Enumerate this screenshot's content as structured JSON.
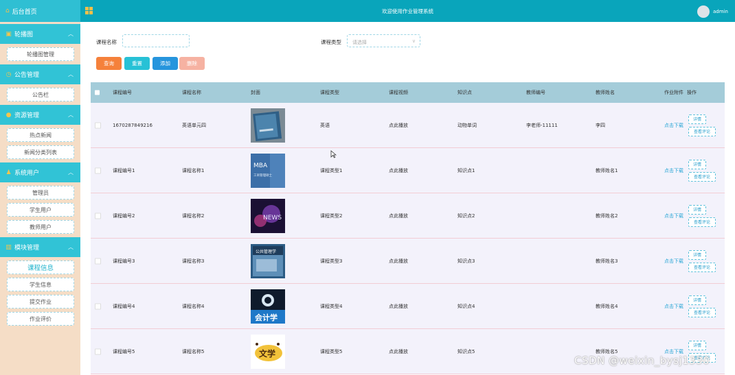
{
  "sidebar": {
    "home": {
      "label": "后台首页",
      "icon": "home-icon"
    },
    "sections": [
      {
        "title": "轮播图",
        "icon": "image-icon",
        "items": [
          "轮播图管理"
        ]
      },
      {
        "title": "公告管理",
        "icon": "clock-icon",
        "items": [
          "公告栏"
        ]
      },
      {
        "title": "资源管理",
        "icon": "pin-icon",
        "items": [
          "热点新闻",
          "新闻分类列表"
        ]
      },
      {
        "title": "系统用户",
        "icon": "user-icon",
        "items": [
          "管理员",
          "学生用户",
          "教师用户"
        ]
      },
      {
        "title": "模块管理",
        "icon": "module-icon",
        "items": [
          "课程信息",
          "学生信息",
          "提交作业",
          "作业评价"
        ]
      }
    ]
  },
  "topbar": {
    "title": "欢迎使用作业管理系统",
    "user": "admin"
  },
  "search": {
    "course_name_label": "课程名称",
    "course_name_value": "",
    "course_type_label": "课程类型",
    "course_type_placeholder": "请选择"
  },
  "buttons": {
    "query": "查询",
    "reset": "重置",
    "add": "添加",
    "delete": "删除"
  },
  "colors": {
    "query": "#f5813b",
    "reset": "#27c1d6",
    "add": "#2695dd",
    "delete": "#f6b2a2",
    "sidebar_head": "#31c3d6",
    "topbar": "#09a5bb"
  },
  "table": {
    "headers": [
      "课程编号",
      "课程名称",
      "封面",
      "课程类型",
      "课程视频",
      "知识点",
      "教师编号",
      "教师姓名",
      "作业附件",
      "操作"
    ],
    "rows": [
      {
        "id": "1670287849216",
        "name": "英语单元四",
        "cover": "cover-book-blue",
        "type": "英语",
        "video": "点此播放",
        "knowledge": "动物单词",
        "teacher_id": "李老师-11111",
        "teacher_name": "李四",
        "attachment": "点击下载"
      },
      {
        "id": "课程编号1",
        "name": "课程名称1",
        "cover": "cover-mba",
        "type": "课程类型1",
        "video": "点此播放",
        "knowledge": "知识点1",
        "teacher_id": "",
        "teacher_name": "教师姓名1",
        "attachment": "点击下载"
      },
      {
        "id": "课程编号2",
        "name": "课程名称2",
        "cover": "cover-news",
        "type": "课程类型2",
        "video": "点此播放",
        "knowledge": "知识点2",
        "teacher_id": "",
        "teacher_name": "教师姓名2",
        "attachment": "点击下载"
      },
      {
        "id": "课程编号3",
        "name": "课程名称3",
        "cover": "cover-management",
        "type": "课程类型3",
        "video": "点此播放",
        "knowledge": "知识点3",
        "teacher_id": "",
        "teacher_name": "教师姓名3",
        "attachment": "点击下载"
      },
      {
        "id": "课程编号4",
        "name": "课程名称4",
        "cover": "cover-accounting",
        "type": "课程类型4",
        "video": "点此播放",
        "knowledge": "知识点4",
        "teacher_id": "",
        "teacher_name": "教师姓名4",
        "attachment": "点击下载"
      },
      {
        "id": "课程编号5",
        "name": "课程名称5",
        "cover": "cover-literature",
        "type": "课程类型5",
        "video": "点此播放",
        "knowledge": "知识点5",
        "teacher_id": "",
        "teacher_name": "教师姓名5",
        "attachment": "点击下载"
      }
    ],
    "op_detail": "详情",
    "op_review": "查看评论"
  },
  "covers": {
    "mba_text": "MBA",
    "mba_sub": "工商管理硕士",
    "news_text": "NEWS",
    "management_text": "公共管理学",
    "accounting_text": "会计学",
    "literature_text": "文学"
  },
  "watermark": "CSDN @weixin_bysj1330"
}
